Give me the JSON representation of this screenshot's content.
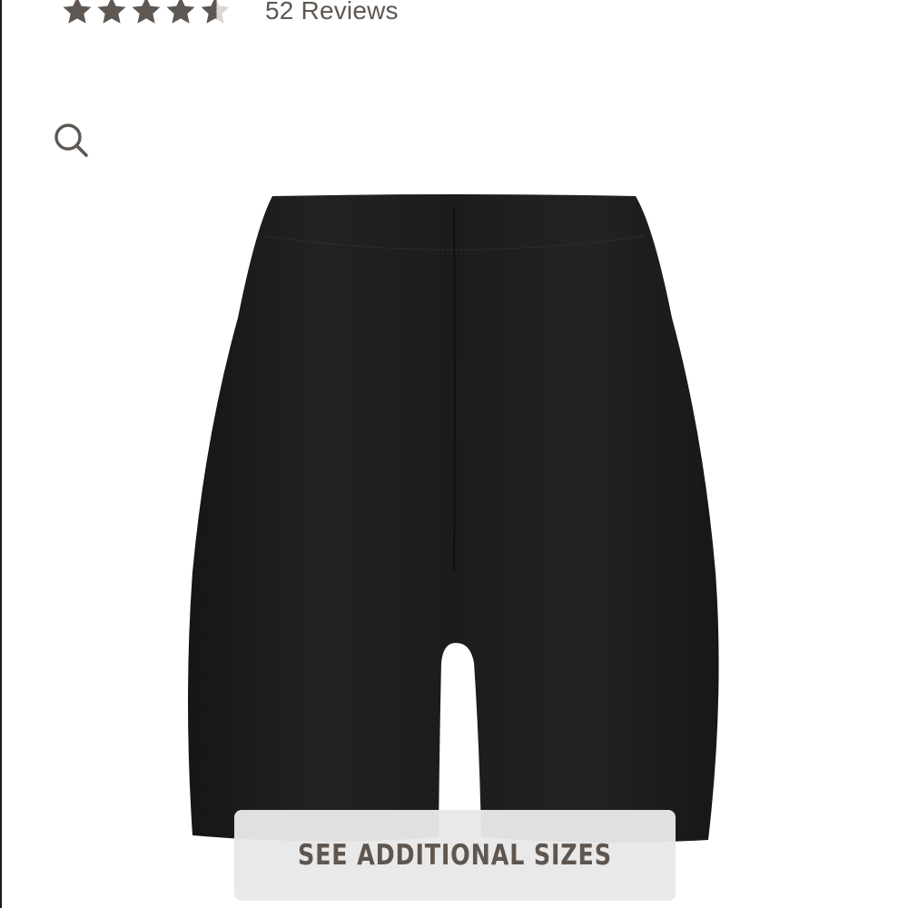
{
  "rating": {
    "stars_value": 4.5,
    "stars_max": 5,
    "review_count_text": "52 Reviews",
    "star_color": "#5e5752"
  },
  "search": {
    "icon": "search-icon",
    "icon_color": "#5e5752"
  },
  "product": {
    "image_icon": "shorts-image",
    "garment_color": "#1f1f1f"
  },
  "sizes_button": {
    "label": "SEE ADDITIONAL SIZES",
    "text_color": "#5f5650",
    "background": "#e8e8e8"
  }
}
